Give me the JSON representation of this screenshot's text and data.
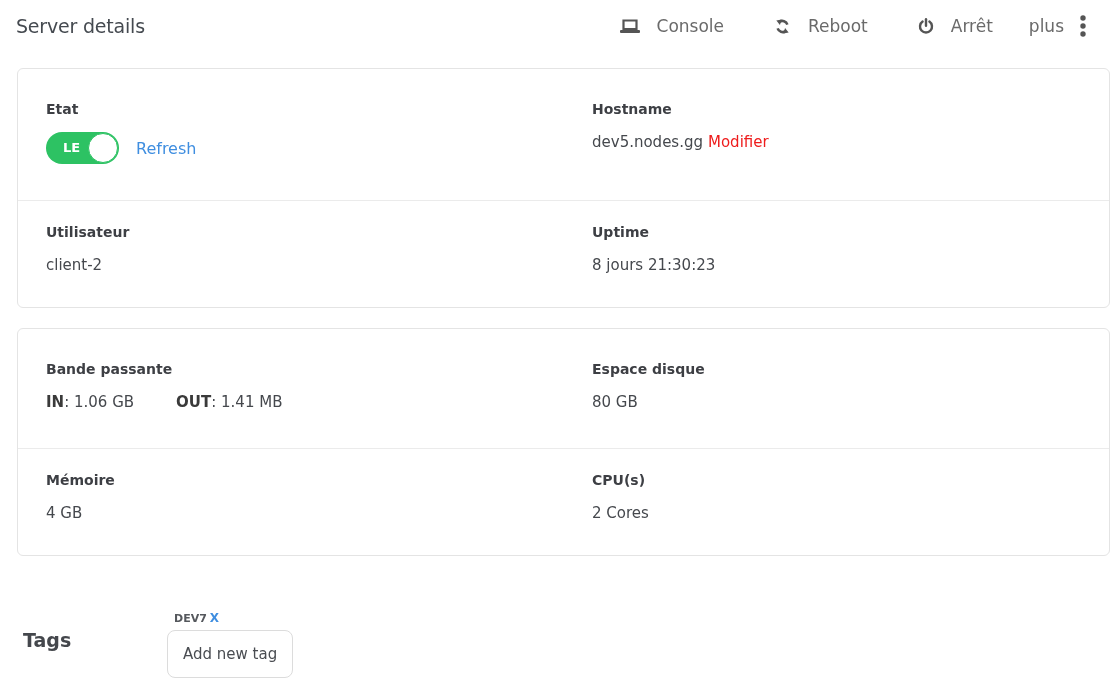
{
  "header": {
    "title": "Server details",
    "actions": [
      {
        "kind": "console",
        "label": "Console"
      },
      {
        "kind": "reboot",
        "label": "Reboot"
      },
      {
        "kind": "power",
        "label": "Arrêt"
      }
    ],
    "more": {
      "label": "plus"
    }
  },
  "cards": [
    {
      "rows": [
        {
          "cells": [
            {
              "kind": "toggle",
              "label": "Etat",
              "toggle": {
                "label": "LE",
                "on": true
              },
              "link": "Refresh"
            },
            {
              "kind": "editable",
              "label": "Hostname",
              "value": "dev5.nodes.gg",
              "link": "Modifier"
            }
          ]
        },
        {
          "cells": [
            {
              "kind": "text",
              "label": "Utilisateur",
              "value": "client-2"
            },
            {
              "kind": "text",
              "label": "Uptime",
              "value": "8 jours 21:30:23"
            }
          ]
        }
      ]
    },
    {
      "rows": [
        {
          "cells": [
            {
              "kind": "pairs",
              "label": "Bande passante",
              "values": [
                "**IN**: 1.06 GB",
                "**OUT**: 1.41 MB"
              ]
            },
            {
              "kind": "text",
              "label": "Espace disque",
              "value": "80 GB"
            }
          ]
        },
        {
          "cells": [
            {
              "kind": "text",
              "label": "Mémoire",
              "value": "4 GB"
            },
            {
              "kind": "text",
              "label": "CPU(s)",
              "value": "2 Cores"
            }
          ]
        }
      ]
    }
  ],
  "tags": {
    "label": "Tags",
    "items": [
      {
        "name": "DEV7",
        "remove": "X"
      }
    ],
    "add_button": "Add new tag"
  }
}
